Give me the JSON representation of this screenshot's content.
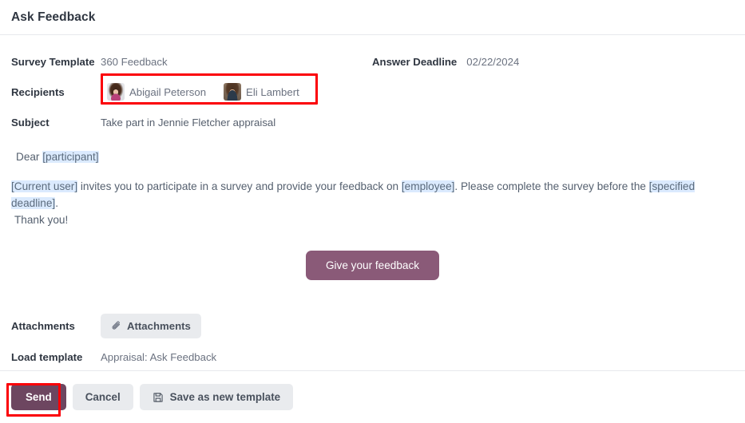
{
  "header": {
    "title": "Ask Feedback"
  },
  "fields": {
    "survey_template_label": "Survey Template",
    "survey_template_value": "360 Feedback",
    "answer_deadline_label": "Answer Deadline",
    "answer_deadline_value": "02/22/2024",
    "recipients_label": "Recipients",
    "subject_label": "Subject",
    "subject_value": "Take part in Jennie Fletcher appraisal",
    "attachments_label": "Attachments",
    "attachments_button": "Attachments",
    "load_template_label": "Load template",
    "load_template_value": "Appraisal: Ask Feedback"
  },
  "recipients": [
    {
      "name": "Abigail Peterson",
      "avatar": "avatar-abigail"
    },
    {
      "name": "Eli Lambert",
      "avatar": "avatar-eli"
    }
  ],
  "message": {
    "greeting_prefix": "Dear ",
    "greeting_tag": "[participant]",
    "p1_tag_user": "[Current user]",
    "p1_mid": " invites you to participate in a survey and provide your feedback on ",
    "p1_tag_employee": "[employee]",
    "p1_mid2": ". Please complete the survey before the ",
    "p1_tag_deadline": "[specified deadline]",
    "p1_end": ".",
    "thanks": "Thank you!",
    "cta_label": "Give your feedback"
  },
  "footer": {
    "send_label": "Send",
    "cancel_label": "Cancel",
    "save_template_label": "Save as new template"
  },
  "icons": {
    "paperclip": "paperclip-icon",
    "save": "floppy-disk-icon"
  },
  "colors": {
    "accent_cta": "#8a5a78",
    "accent_send": "#6d4660",
    "tag_highlight": "#dbeafe",
    "highlight_box": "#fb0007"
  }
}
